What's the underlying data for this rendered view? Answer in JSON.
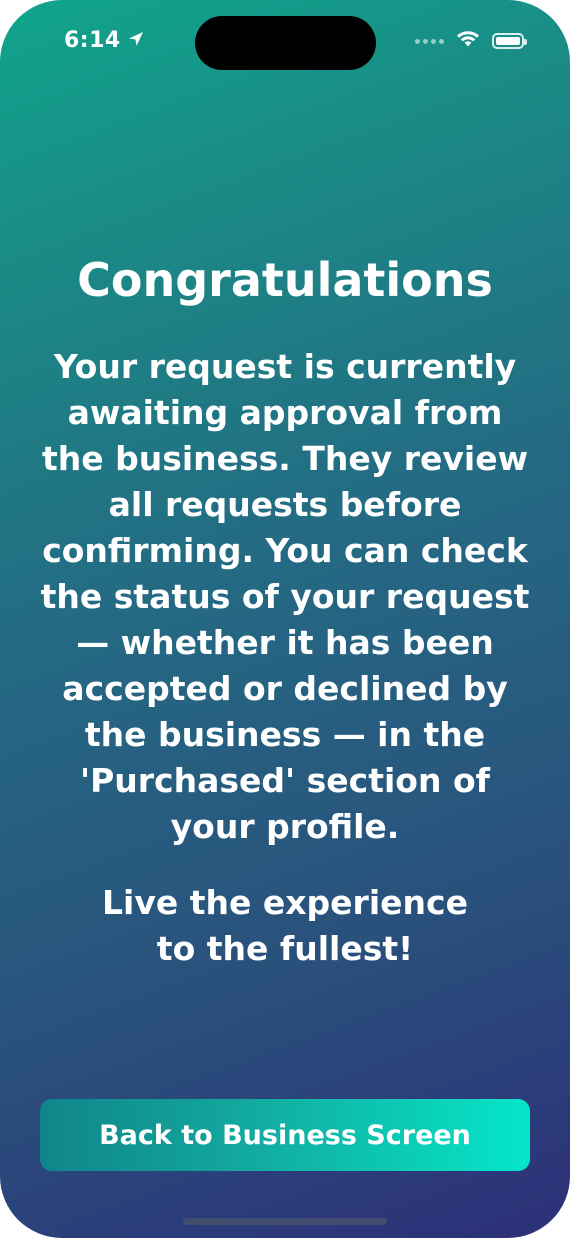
{
  "status_bar": {
    "time": "6:14",
    "location_icon": "location-arrow-icon",
    "signal_icon": "cellular-signal-icon",
    "wifi_icon": "wifi-icon",
    "battery_icon": "battery-icon"
  },
  "main": {
    "title": "Congratulations",
    "message": "Your request is currently awaiting approval from the business. They review all requests before confirming. You can check the status of your request — whether it has been accepted or declined by the business — in the 'Purchased' section of your profile.",
    "tagline": "Live the experience to the fullest!"
  },
  "actions": {
    "back_label": "Back to Business Screen"
  },
  "colors": {
    "gradient_top": "#10a58c",
    "gradient_bottom": "#2c2f78",
    "button_start": "#0f858a",
    "button_end": "#05e6c8",
    "text": "#ffffff"
  }
}
